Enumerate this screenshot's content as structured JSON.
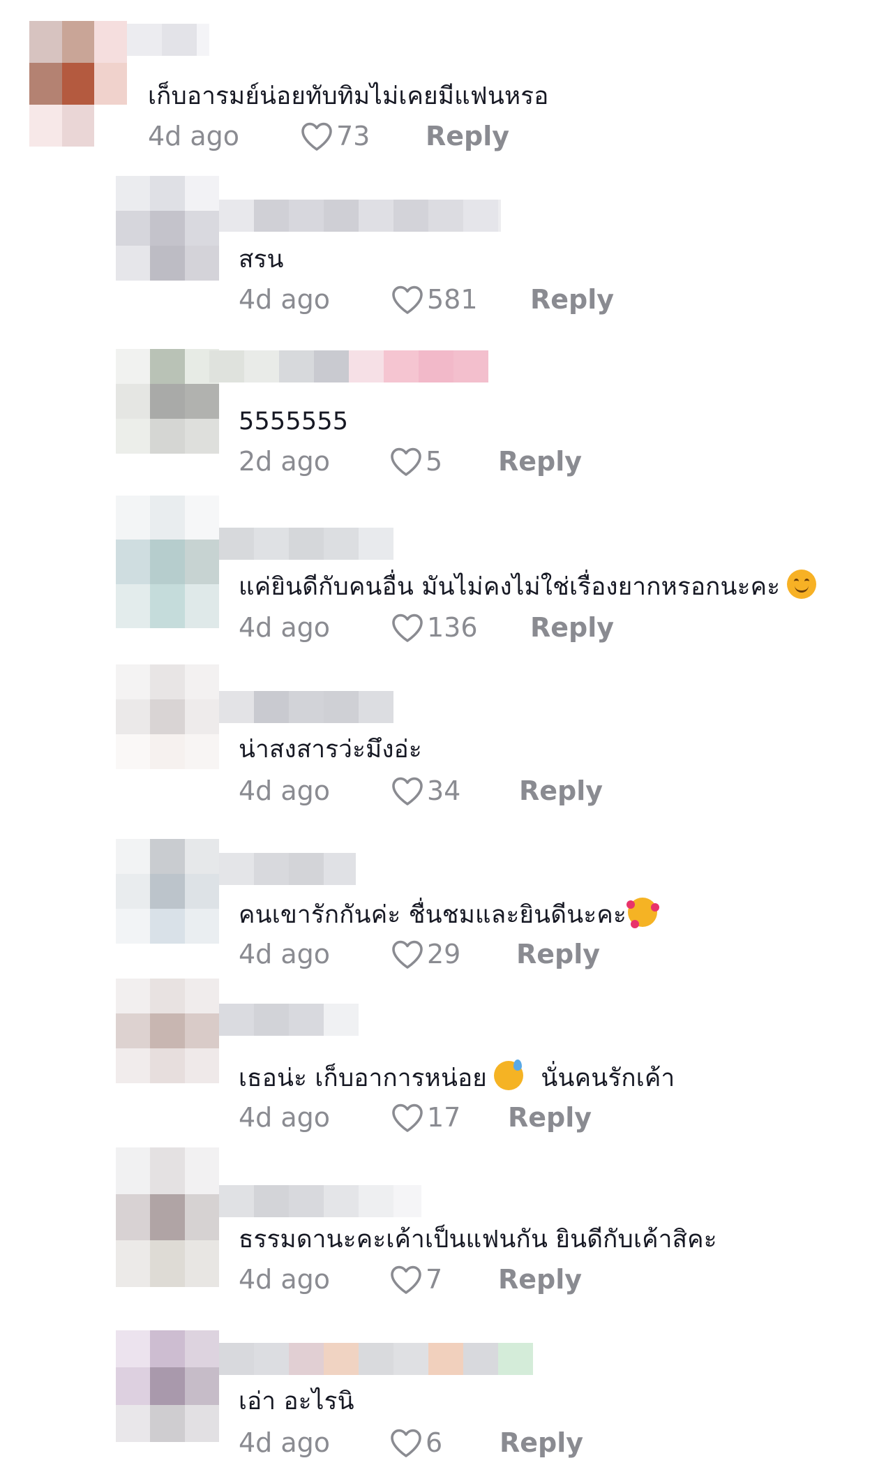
{
  "comments": [
    {
      "text": "เก็บอารมย์น่อยทับทิมไม่เคยมีแฟนหรอ",
      "date": "4d ago",
      "likes": "73",
      "reply": "Reply",
      "emoji": ""
    },
    {
      "text": "สรน",
      "date": "4d ago",
      "likes": "581",
      "reply": "Reply",
      "emoji": ""
    },
    {
      "text": "5555555",
      "date": "2d ago",
      "likes": "5",
      "reply": "Reply",
      "emoji": ""
    },
    {
      "text": "แค่ยินดีกับคนอื่น มันไม่คงไม่ใช่เรื่องยากหรอกนะคะ",
      "date": "4d ago",
      "likes": "136",
      "reply": "Reply",
      "emoji": "smiling-face-icon"
    },
    {
      "text": "น่าสงสารว่ะมึงอ่ะ",
      "date": "4d ago",
      "likes": "34",
      "reply": "Reply",
      "emoji": ""
    },
    {
      "text": "คนเขารักกันค่ะ ชื่นชมและยินดีนะคะ",
      "date": "4d ago",
      "likes": "29",
      "reply": "Reply",
      "emoji": "smiling-face-with-hearts-icon"
    },
    {
      "text": "เธอน่ะ เก็บอาการหน่อย",
      "text_after": "นั่นคนรักเค้า",
      "date": "4d ago",
      "likes": "17",
      "reply": "Reply",
      "emoji": "grinning-sweat-icon"
    },
    {
      "text": "ธรรมดานะคะเค้าเป็นแฟนกัน ยินดีกับเค้าสิคะ",
      "date": "4d ago",
      "likes": "7",
      "reply": "Reply",
      "emoji": ""
    },
    {
      "text": "เอ่า อะไรนิ",
      "date": "4d ago",
      "likes": "6",
      "reply": "Reply",
      "emoji": ""
    }
  ],
  "colors": {
    "text": "#161823",
    "muted": "#8a8b91",
    "background": "#ffffff"
  }
}
